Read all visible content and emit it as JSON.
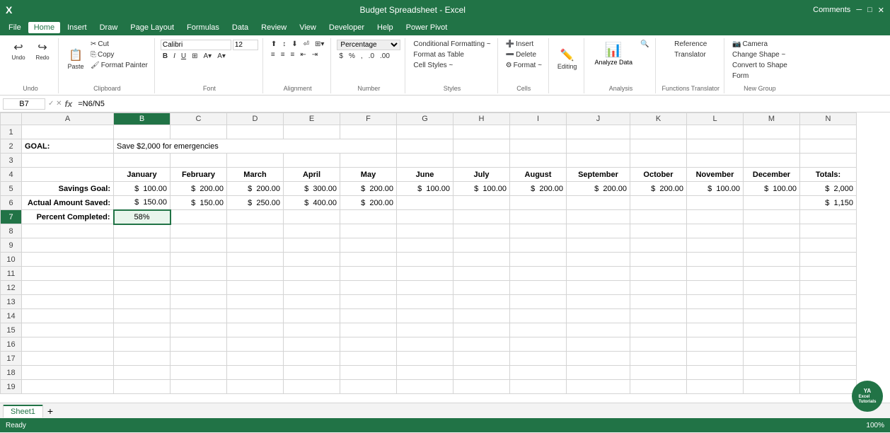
{
  "titleBar": {
    "title": "Budget Spreadsheet - Excel",
    "comments": "Comments"
  },
  "menuBar": {
    "items": [
      "File",
      "Home",
      "Insert",
      "Draw",
      "Page Layout",
      "Formulas",
      "Data",
      "Review",
      "View",
      "Developer",
      "Help",
      "Power Pivot"
    ]
  },
  "ribbon": {
    "activeTab": "Home",
    "groups": {
      "undo": {
        "label": "Undo",
        "undoIcon": "↩",
        "redoIcon": "↪"
      },
      "clipboard": {
        "label": "Clipboard",
        "paste": "Paste",
        "cut": "Cut",
        "copy": "Copy",
        "formatPainter": "Format Painter"
      },
      "font": {
        "label": "Font",
        "fontName": "Calibri",
        "fontSize": "12",
        "bold": "B",
        "italic": "I",
        "underline": "U"
      },
      "alignment": {
        "label": "Alignment"
      },
      "number": {
        "label": "Number",
        "format": "Percentage"
      },
      "styles": {
        "label": "Styles",
        "conditionalFormatting": "Conditional Formatting ~",
        "formatAsTable": "Format as Table",
        "cellStyles": "Cell Styles ~"
      },
      "cells": {
        "label": "Cells",
        "insert": "Insert",
        "delete": "Delete",
        "format": "Format ~"
      },
      "editing": {
        "label": "Editing",
        "label2": "Editing"
      },
      "analysis": {
        "label": "Analysis",
        "analyzeData": "Analyze Data"
      },
      "functionsTranslator": {
        "label": "Functions Translator",
        "reference": "Reference",
        "translator": "Translator"
      },
      "newGroup": {
        "label": "New Group",
        "camera": "Camera",
        "changeShape": "Change Shape ~",
        "convertToShape": "Convert to Shape",
        "form": "Form"
      }
    }
  },
  "formulaBar": {
    "cellRef": "B7",
    "formula": "=N6/N5"
  },
  "columns": {
    "headers": [
      "",
      "A",
      "B",
      "C",
      "D",
      "E",
      "F",
      "G",
      "H",
      "I",
      "J",
      "K",
      "L",
      "M",
      "N"
    ],
    "widths": [
      30,
      130,
      80,
      80,
      80,
      80,
      80,
      80,
      80,
      80,
      80,
      80,
      80,
      80,
      80
    ]
  },
  "rows": {
    "count": 19,
    "data": {
      "1": {},
      "2": {
        "A": "GOAL:",
        "B": "Save $2,000 for emergencies"
      },
      "3": {},
      "4": {
        "B": "January",
        "C": "February",
        "D": "March",
        "E": "April",
        "F": "May",
        "G": "June",
        "H": "July",
        "I": "August",
        "J": "September",
        "K": "October",
        "L": "November",
        "M": "December",
        "N": "Totals:"
      },
      "5": {
        "A": "Savings Goal:",
        "B": "$  100.00",
        "C": "$  200.00",
        "D": "$  200.00",
        "E": "$  300.00",
        "F": "$  200.00",
        "G": "$  100.00",
        "H": "$  100.00",
        "I": "$  200.00",
        "J": "$  200.00",
        "K": "$  200.00",
        "L": "$  100.00",
        "M": "$  100.00",
        "N": "$  2,000"
      },
      "6": {
        "A": "Actual Amount Saved:",
        "B": "$  150.00",
        "C": "$  150.00",
        "D": "$  250.00",
        "E": "$  400.00",
        "F": "$  200.00",
        "N": "$  1,150"
      },
      "7": {
        "A": "Percent Completed:",
        "B": "58%"
      }
    }
  },
  "sheetTabs": {
    "tabs": [
      "Sheet1"
    ],
    "active": "Sheet1"
  },
  "statusBar": {
    "mode": "Ready",
    "zoom": "100%"
  }
}
